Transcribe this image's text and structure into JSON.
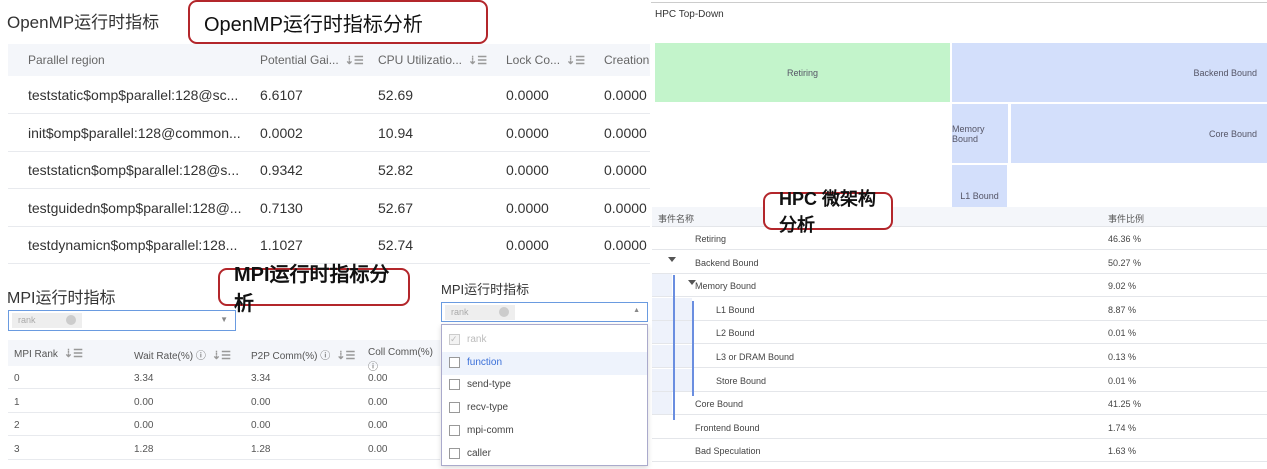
{
  "openmp": {
    "title": "OpenMP运行时指标",
    "callout": "OpenMP运行时指标分析",
    "columns": [
      "Parallel region",
      "Potential Gai...",
      "CPU Utilizatio...",
      "Lock Co...",
      "Creation"
    ],
    "rows": [
      [
        "teststatic$omp$parallel:128@sc...",
        "6.6107",
        "52.69",
        "0.0000",
        "0.0000"
      ],
      [
        "init$omp$parallel:128@common...",
        "0.0002",
        "10.94",
        "0.0000",
        "0.0000"
      ],
      [
        "teststaticn$omp$parallel:128@s...",
        "0.9342",
        "52.82",
        "0.0000",
        "0.0000"
      ],
      [
        "testguidedn$omp$parallel:128@...",
        "0.7130",
        "52.67",
        "0.0000",
        "0.0000"
      ],
      [
        "testdynamicn$omp$parallel:128...",
        "1.1027",
        "52.74",
        "0.0000",
        "0.0000"
      ]
    ]
  },
  "mpi": {
    "title": "MPI运行时指标",
    "callout": "MPI运行时指标分析",
    "select_tag": "rank",
    "columns": [
      "MPI Rank",
      "Wait Rate(%)",
      "P2P Comm(%)",
      "Coll Comm(%)"
    ],
    "rows": [
      [
        "0",
        "3.34",
        "3.34",
        "0.00"
      ],
      [
        "1",
        "0.00",
        "0.00",
        "0.00"
      ],
      [
        "2",
        "0.00",
        "0.00",
        "0.00"
      ],
      [
        "3",
        "1.28",
        "1.28",
        "0.00"
      ]
    ]
  },
  "mpi_dropdown": {
    "title": "MPI运行时指标",
    "select_tag": "rank",
    "options": [
      {
        "label": "rank",
        "checked": true,
        "disabled": true
      },
      {
        "label": "function",
        "checked": false,
        "highlight": true
      },
      {
        "label": "send-type",
        "checked": false
      },
      {
        "label": "recv-type",
        "checked": false
      },
      {
        "label": "mpi-comm",
        "checked": false
      },
      {
        "label": "caller",
        "checked": false
      }
    ]
  },
  "hpc": {
    "title": "HPC Top-Down",
    "callout": "HPC 微架构分析",
    "treemap": {
      "retiring": "Retiring",
      "backend": "Backend Bound",
      "memory": "Memory Bound",
      "core": "Core Bound",
      "l1": "L1 Bound"
    },
    "colors": {
      "retiring": "#c3f4cb",
      "backend": "#d3dffb"
    },
    "columns": [
      "事件名称",
      "事件比例"
    ],
    "rows": [
      {
        "name": "Retiring",
        "pct": "46.36 %"
      },
      {
        "name": "Backend Bound",
        "pct": "50.27 %"
      },
      {
        "name": "Memory Bound",
        "pct": "9.02 %"
      },
      {
        "name": "L1 Bound",
        "pct": "8.87 %"
      },
      {
        "name": "L2 Bound",
        "pct": "0.01 %"
      },
      {
        "name": "L3 or DRAM Bound",
        "pct": "0.13 %"
      },
      {
        "name": "Store Bound",
        "pct": "0.01 %"
      },
      {
        "name": "Core Bound",
        "pct": "41.25 %"
      },
      {
        "name": "Frontend Bound",
        "pct": "1.74 %"
      },
      {
        "name": "Bad Speculation",
        "pct": "1.63 %"
      }
    ]
  }
}
